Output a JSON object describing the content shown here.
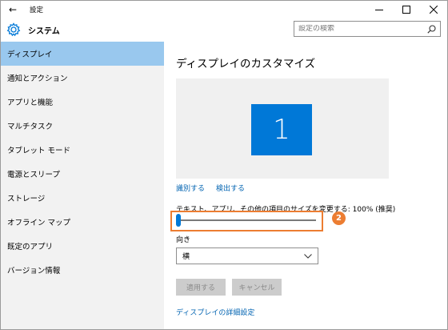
{
  "window": {
    "title": "設定",
    "controls": [
      "minimize-icon",
      "maximize-icon",
      "close-icon"
    ]
  },
  "header": {
    "title": "システム",
    "icon": "gear-icon",
    "search_placeholder": "設定の検索",
    "search_icon": "search-icon"
  },
  "sidebar": {
    "items": [
      {
        "label": "ディスプレイ",
        "active": true
      },
      {
        "label": "通知とアクション",
        "active": false
      },
      {
        "label": "アプリと機能",
        "active": false
      },
      {
        "label": "マルチタスク",
        "active": false
      },
      {
        "label": "タブレット モード",
        "active": false
      },
      {
        "label": "電源とスリープ",
        "active": false
      },
      {
        "label": "ストレージ",
        "active": false
      },
      {
        "label": "オフライン マップ",
        "active": false
      },
      {
        "label": "既定のアプリ",
        "active": false
      },
      {
        "label": "バージョン情報",
        "active": false
      }
    ]
  },
  "main": {
    "title": "ディスプレイのカスタマイズ",
    "monitor_number": "1",
    "identify_link": "識別する",
    "detect_link": "検出する",
    "scale_label": "テキスト、アプリ、その他の項目のサイズを変更する: 100% (推奨)",
    "scale_value_fraction": 0,
    "step_badge": "2",
    "orientation_label": "向き",
    "orientation_value": "横",
    "apply_button": "適用する",
    "cancel_button": "キャンセル",
    "advanced_link": "ディスプレイの詳細設定"
  },
  "colors": {
    "accent": "#0078d7",
    "sidebar_active": "#99c8ee",
    "link": "#0063b1",
    "highlight": "#ec7d32"
  }
}
